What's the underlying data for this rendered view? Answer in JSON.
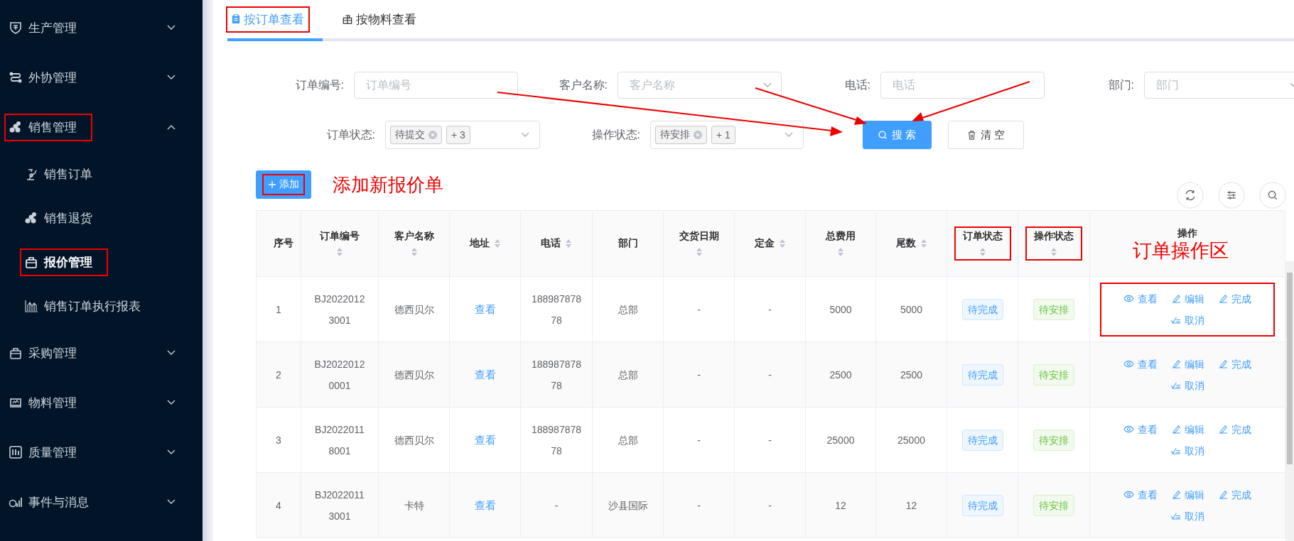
{
  "sidebar": {
    "items": [
      {
        "label": "生产管理",
        "expanded": false,
        "highlighted": false
      },
      {
        "label": "外协管理",
        "expanded": false,
        "highlighted": false
      },
      {
        "label": "销售管理",
        "expanded": true,
        "highlighted": true,
        "children": [
          {
            "label": "销售订单",
            "selected": false,
            "highlighted": false
          },
          {
            "label": "销售退货",
            "selected": false,
            "highlighted": false
          },
          {
            "label": "报价管理",
            "selected": true,
            "highlighted": true
          },
          {
            "label": "销售订单执行报表",
            "selected": false,
            "highlighted": false
          }
        ]
      },
      {
        "label": "采购管理",
        "expanded": false,
        "highlighted": false
      },
      {
        "label": "物料管理",
        "expanded": false,
        "highlighted": false
      },
      {
        "label": "质量管理",
        "expanded": false,
        "highlighted": false
      },
      {
        "label": "事件与消息",
        "expanded": false,
        "highlighted": false
      }
    ]
  },
  "tabs": [
    {
      "label": "按订单查看",
      "selected": true,
      "highlighted": true
    },
    {
      "label": "按物料查看",
      "selected": false,
      "highlighted": false
    }
  ],
  "filters": {
    "fields": [
      {
        "label": "订单编号:",
        "placeholder": "订单编号",
        "kind": "input"
      },
      {
        "label": "客户名称:",
        "placeholder": "客户名称",
        "kind": "select"
      },
      {
        "label": "电话:",
        "placeholder": "电话",
        "kind": "input"
      },
      {
        "label": "部门:",
        "placeholder": "部门",
        "kind": "select"
      }
    ],
    "status_fields": [
      {
        "label": "订单状态:",
        "tags": [
          {
            "label": "待提交",
            "closable": true
          },
          {
            "label": "+ 3",
            "closable": false
          }
        ]
      },
      {
        "label": "操作状态:",
        "tags": [
          {
            "label": "待安排",
            "closable": true
          },
          {
            "label": "+ 1",
            "closable": false
          }
        ]
      }
    ],
    "search_button": "搜 索",
    "clear_button": "清 空"
  },
  "add_button": {
    "label": "添加",
    "highlighted": true
  },
  "annotations": [
    "添加新报价单",
    "订单操作区"
  ],
  "table": {
    "columns": [
      {
        "label": "序号",
        "sortable": false,
        "highlighted": false
      },
      {
        "label": "订单编号",
        "sortable": true,
        "highlighted": false
      },
      {
        "label": "客户名称",
        "sortable": true,
        "highlighted": false
      },
      {
        "label": "地址",
        "sortable": true,
        "highlighted": false
      },
      {
        "label": "电话",
        "sortable": true,
        "highlighted": false
      },
      {
        "label": "部门",
        "sortable": false,
        "highlighted": false
      },
      {
        "label": "交货日期",
        "sortable": true,
        "highlighted": false
      },
      {
        "label": "定金",
        "sortable": true,
        "highlighted": false
      },
      {
        "label": "总费用",
        "sortable": true,
        "highlighted": false
      },
      {
        "label": "尾数",
        "sortable": true,
        "highlighted": false
      },
      {
        "label": "订单状态",
        "sortable": true,
        "highlighted": true
      },
      {
        "label": "操作状态",
        "sortable": true,
        "highlighted": true
      },
      {
        "label": "操作",
        "sortable": false,
        "highlighted": false
      }
    ],
    "rows": [
      {
        "index": "1",
        "order_no": "BJ20220123001",
        "customer": "德西贝尔",
        "address": "查看",
        "phone": "18898787878",
        "dept": "总部",
        "delivery_date": "-",
        "deposit": "-",
        "total": "5000",
        "balance": "5000",
        "order_status": {
          "label": "待完成",
          "color": "#409eff"
        },
        "op_status": {
          "label": "待安排",
          "color": "#67c23a"
        },
        "actions_highlighted": true,
        "actions": [
          {
            "label": "查看",
            "kind": "view"
          },
          {
            "label": "编辑",
            "kind": "edit"
          },
          {
            "label": "完成",
            "kind": "complete"
          },
          {
            "label": "取消",
            "kind": "cancel"
          }
        ]
      },
      {
        "index": "2",
        "order_no": "BJ20220120001",
        "customer": "德西贝尔",
        "address": "查看",
        "phone": "18898787878",
        "dept": "总部",
        "delivery_date": "-",
        "deposit": "-",
        "total": "2500",
        "balance": "2500",
        "order_status": {
          "label": "待完成",
          "color": "#409eff"
        },
        "op_status": {
          "label": "待安排",
          "color": "#67c23a"
        },
        "actions_highlighted": false,
        "actions": [
          {
            "label": "查看",
            "kind": "view"
          },
          {
            "label": "编辑",
            "kind": "edit"
          },
          {
            "label": "完成",
            "kind": "complete"
          },
          {
            "label": "取消",
            "kind": "cancel"
          }
        ]
      },
      {
        "index": "3",
        "order_no": "BJ20220118001",
        "customer": "德西贝尔",
        "address": "查看",
        "phone": "18898787878",
        "dept": "总部",
        "delivery_date": "-",
        "deposit": "-",
        "total": "25000",
        "balance": "25000",
        "order_status": {
          "label": "待完成",
          "color": "#409eff"
        },
        "op_status": {
          "label": "待安排",
          "color": "#67c23a"
        },
        "actions_highlighted": false,
        "actions": [
          {
            "label": "查看",
            "kind": "view"
          },
          {
            "label": "编辑",
            "kind": "edit"
          },
          {
            "label": "完成",
            "kind": "complete"
          },
          {
            "label": "取消",
            "kind": "cancel"
          }
        ]
      },
      {
        "index": "4",
        "order_no": "BJ20220113001",
        "customer": "卡特",
        "address": "查看",
        "phone": "-",
        "dept": "沙县国际",
        "delivery_date": "-",
        "deposit": "-",
        "total": "12",
        "balance": "12",
        "order_status": {
          "label": "待完成",
          "color": "#409eff"
        },
        "op_status": {
          "label": "待安排",
          "color": "#67c23a"
        },
        "actions_highlighted": false,
        "actions": [
          {
            "label": "查看",
            "kind": "view"
          },
          {
            "label": "编辑",
            "kind": "edit"
          },
          {
            "label": "完成",
            "kind": "complete"
          },
          {
            "label": "取消",
            "kind": "cancel"
          }
        ]
      }
    ]
  }
}
